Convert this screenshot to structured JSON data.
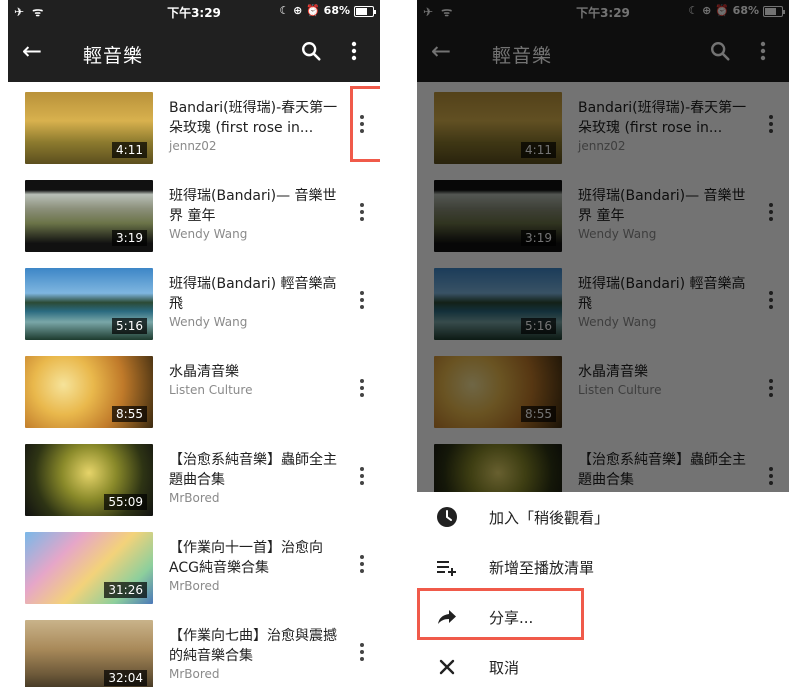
{
  "status_bar": {
    "left_icons": "✈ ᯤ",
    "time": "下午3:29",
    "right_icons": "☾ ⊕ ⏰ 68%",
    "battery": "68%"
  },
  "app_bar": {
    "back_icon": "arrow-back",
    "title": "輕音樂",
    "search_icon": "search",
    "more_icon": "more-vert"
  },
  "videos": [
    {
      "title": "Bandari(班得瑞)-春天第一朵玫瑰 (first rose in...",
      "channel": "jennz02",
      "duration": "4:11",
      "thumb": "golden-field"
    },
    {
      "title": "班得瑞(Bandari)— 音樂世界  童年",
      "channel": "Wendy Wang",
      "duration": "3:19",
      "thumb": "rural-field"
    },
    {
      "title": "班得瑞(Bandari)  輕音樂高飛",
      "channel": "Wendy Wang",
      "duration": "5:16",
      "thumb": "seascape"
    },
    {
      "title": "水晶清音樂",
      "channel": "Listen Culture",
      "duration": "8:55",
      "thumb": "bokeh"
    },
    {
      "title": "【治愈系純音樂】蟲師全主題曲合集",
      "channel": "MrBored",
      "duration": "55:09",
      "thumb": "forest"
    },
    {
      "title": "【作業向十一首】治愈向ACG純音樂合集",
      "channel": "MrBored",
      "duration": "31:26",
      "thumb": "anime"
    },
    {
      "title": "【作業向七曲】治愈與震撼的純音樂合集",
      "channel": "MrBored",
      "duration": "32:04",
      "thumb": "ruins"
    }
  ],
  "menu": {
    "options": [
      {
        "icon": "clock-icon",
        "label": "加入「稍後觀看」"
      },
      {
        "icon": "add-to-playlist-icon",
        "label": "新增至播放清單"
      },
      {
        "icon": "share-icon",
        "label": "分享..."
      },
      {
        "icon": "close-icon",
        "label": "取消"
      }
    ]
  },
  "colors": {
    "appbar": "#202020",
    "highlight": "#f05a4a",
    "overlay": "rgba(0,0,0,0.55)"
  }
}
